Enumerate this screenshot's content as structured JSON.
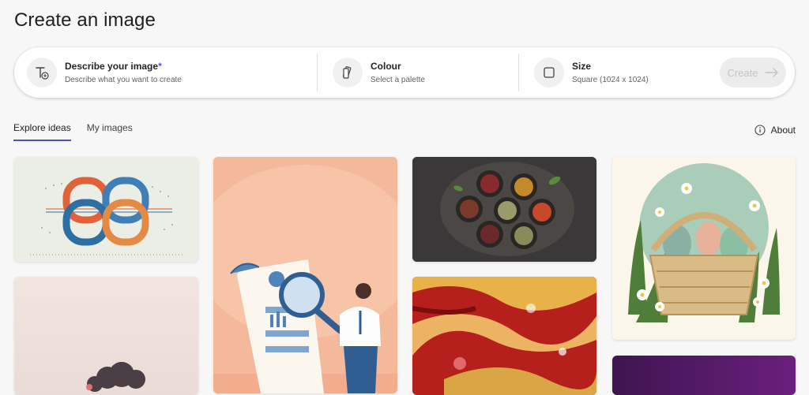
{
  "page": {
    "title": "Create an image"
  },
  "prompt_bar": {
    "describe": {
      "label": "Describe your image",
      "required_mark": "*",
      "placeholder": "Describe what you want to create",
      "icon": "text-add-icon"
    },
    "colour": {
      "label": "Colour",
      "value": "Select a palette",
      "icon": "palette-icon"
    },
    "size": {
      "label": "Size",
      "value": "Square (1024 x 1024)",
      "icon": "square-icon"
    },
    "create_label": "Create"
  },
  "tabs": [
    {
      "label": "Explore ideas",
      "active": true
    },
    {
      "label": "My images",
      "active": false
    }
  ],
  "about_label": "About",
  "gallery": [
    {
      "subject": "interlocking-rings"
    },
    {
      "subject": "document-magnifier-person"
    },
    {
      "subject": "spice-bowls"
    },
    {
      "subject": "easter-basket"
    },
    {
      "subject": "pink-clouds"
    },
    {
      "subject": "liquid-gold-red"
    },
    {
      "subject": "purple-gradient"
    }
  ],
  "colors": {
    "accent": "#4f52b2",
    "required": "#7b3fe4",
    "background": "#f7f7f7"
  }
}
